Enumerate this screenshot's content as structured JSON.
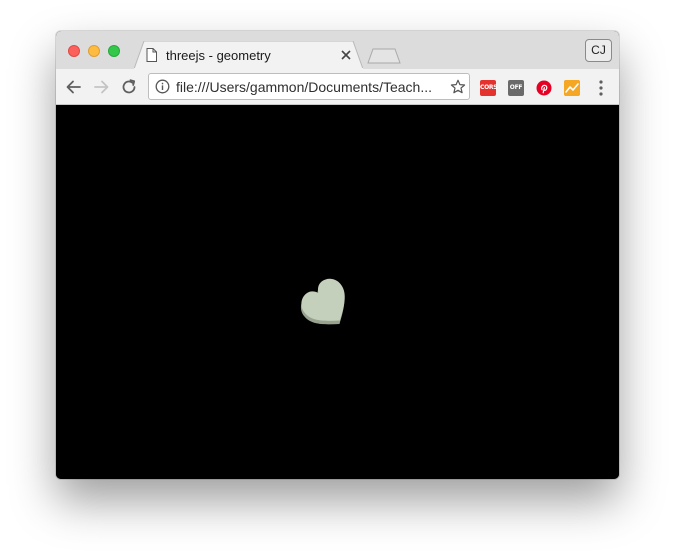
{
  "window": {
    "tab": {
      "title": "threejs - geometry",
      "icon": "document-icon"
    },
    "profile": {
      "initials": "CJ"
    }
  },
  "toolbar": {
    "url": "file:///Users/gammon/Documents/Teach...",
    "extensions": [
      {
        "name": "cors-extension-icon",
        "label": "CORS",
        "color": "#e4322f"
      },
      {
        "name": "off-extension-icon",
        "label": "OFF",
        "color": "#6a6a6a"
      },
      {
        "name": "pinterest-icon",
        "label": "",
        "color": "#e60023"
      },
      {
        "name": "chart-extension-icon",
        "label": "",
        "color": "#f5a623"
      }
    ]
  },
  "scene": {
    "background": "#000000",
    "object": "heart-shape",
    "object_color": "#c4cfbc"
  },
  "colors": {
    "close": "#fc605c",
    "minimize": "#fdbc40",
    "maximize": "#34c84a"
  }
}
